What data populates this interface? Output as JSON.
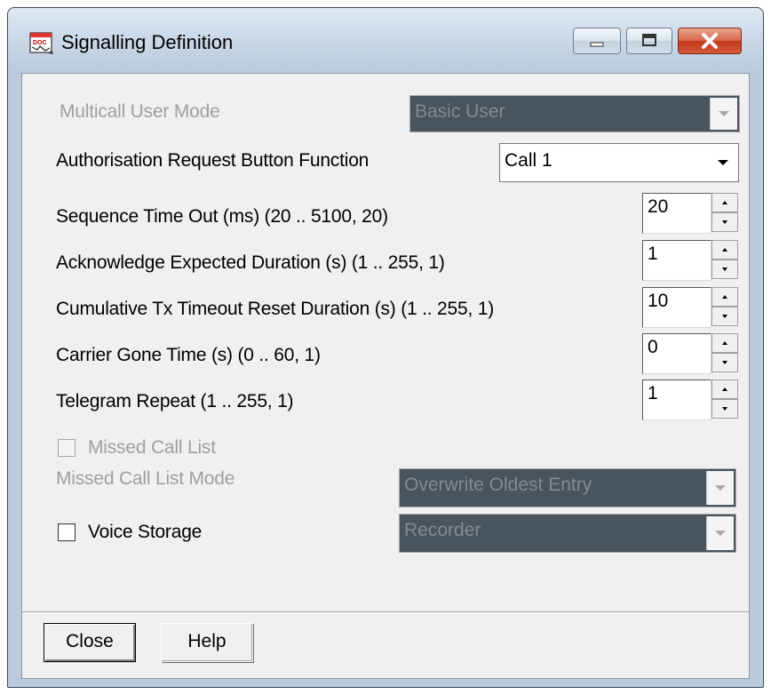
{
  "window": {
    "title": "Signalling Definition",
    "icon": "doc-window-icon"
  },
  "titlebar_buttons": {
    "minimize": "minimize-icon",
    "maximize": "maximize-icon",
    "close": "close-icon"
  },
  "fields": {
    "multicall_user_mode": {
      "label": "Multicall User Mode",
      "value": "Basic User",
      "enabled": false
    },
    "auth_request_button_function": {
      "label": "Authorisation Request Button Function",
      "value": "Call 1",
      "enabled": true
    },
    "sequence_time_out": {
      "label": "Sequence Time Out (ms) (20 .. 5100, 20)",
      "value": "20"
    },
    "ack_expected_duration": {
      "label": "Acknowledge Expected Duration (s) (1 .. 255, 1)",
      "value": "1"
    },
    "cumulative_tx_timeout_reset": {
      "label": "Cumulative Tx Timeout Reset Duration (s) (1 .. 255, 1)",
      "value": "10"
    },
    "carrier_gone_time": {
      "label": "Carrier Gone Time (s) (0 .. 60, 1)",
      "value": "0"
    },
    "telegram_repeat": {
      "label": "Telegram Repeat (1 .. 255, 1)",
      "value": "1"
    },
    "missed_call_list": {
      "label": "Missed Call List",
      "checked": false,
      "enabled": false
    },
    "missed_call_list_mode": {
      "label": "Missed Call List Mode",
      "value": "Overwrite Oldest Entry",
      "enabled": false
    },
    "voice_storage": {
      "label": "Voice Storage",
      "checked": false,
      "enabled": true,
      "mode_value": "Recorder",
      "mode_enabled": false
    }
  },
  "buttons": {
    "close": "Close",
    "help": "Help"
  },
  "colors": {
    "disabled_combo_bg": "#4a545c",
    "disabled_text": "#a0a0a0",
    "dialog_bg": "#f0f0f0",
    "close_button_red": "#c4381c"
  }
}
